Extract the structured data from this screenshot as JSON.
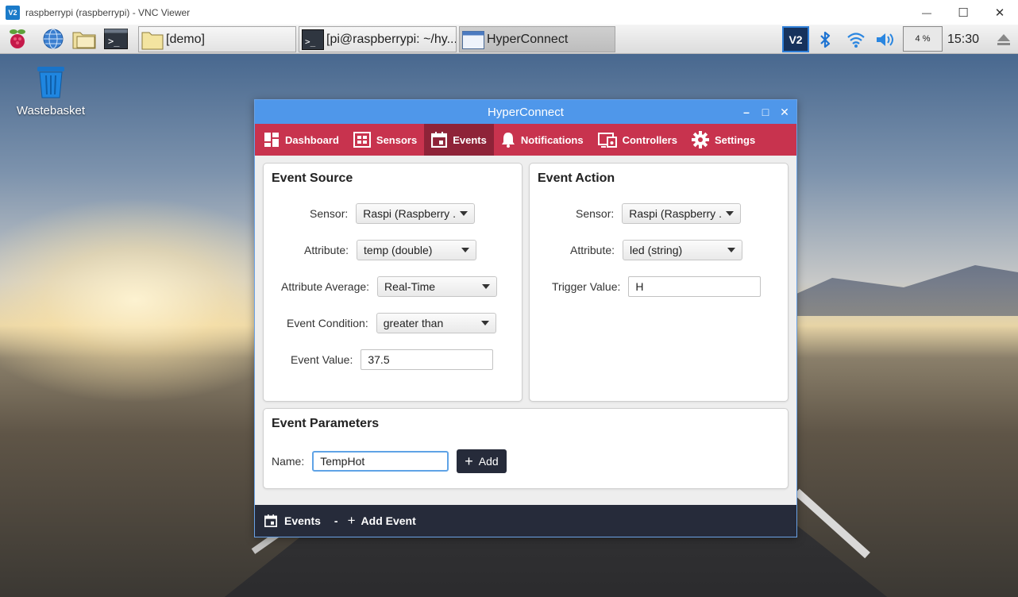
{
  "vnc": {
    "title": "raspberrypi (raspberrypi) - VNC Viewer",
    "logo": "V2",
    "controls": {
      "minimize": "—",
      "maximize": "☐",
      "close": "✕"
    }
  },
  "taskbar": {
    "launchers": [
      "raspberry-menu-icon",
      "web-browser-icon",
      "file-manager-icon",
      "terminal-icon"
    ],
    "tasks": [
      {
        "label": "[demo]",
        "icon": "folder-icon"
      },
      {
        "label": "[pi@raspberrypi: ~/hy...",
        "icon": "terminal-icon"
      },
      {
        "label": "HyperConnect",
        "icon": "window-icon"
      }
    ],
    "tray": {
      "vnc_label": "V2",
      "cpu": "4 %",
      "clock": "15:30"
    }
  },
  "desktop": {
    "wastebasket_label": "Wastebasket"
  },
  "app": {
    "title": "HyperConnect",
    "controls": {
      "minimize": "–",
      "maximize": "□",
      "close": "✕"
    },
    "tabs": [
      {
        "label": "Dashboard",
        "icon": "dashboard-icon",
        "active": false
      },
      {
        "label": "Sensors",
        "icon": "sensors-icon",
        "active": false
      },
      {
        "label": "Events",
        "icon": "calendar-icon",
        "active": true
      },
      {
        "label": "Notifications",
        "icon": "bell-icon",
        "active": false
      },
      {
        "label": "Controllers",
        "icon": "controllers-icon",
        "active": false
      },
      {
        "label": "Settings",
        "icon": "gear-icon",
        "active": false
      }
    ],
    "event_source": {
      "title": "Event Source",
      "sensor_label": "Sensor:",
      "sensor_value": "Raspi (Raspberry ...",
      "attribute_label": "Attribute:",
      "attribute_value": "temp (double)",
      "average_label": "Attribute Average:",
      "average_value": "Real-Time",
      "condition_label": "Event Condition:",
      "condition_value": "greater than",
      "value_label": "Event Value:",
      "value_value": "37.5"
    },
    "event_action": {
      "title": "Event Action",
      "sensor_label": "Sensor:",
      "sensor_value": "Raspi (Raspberry ...",
      "attribute_label": "Attribute:",
      "attribute_value": "led (string)",
      "trigger_label": "Trigger Value:",
      "trigger_value": "H"
    },
    "event_parameters": {
      "title": "Event Parameters",
      "name_label": "Name:",
      "name_value": "TempHot",
      "add_label": "Add"
    },
    "footer": {
      "events_label": "Events",
      "separator": "-",
      "add_event_label": "Add Event"
    },
    "colors": {
      "tab_bar": "#c8334e",
      "tab_active": "#8e2338",
      "title_bar": "#4f97ea",
      "footer": "#262b3a"
    }
  }
}
